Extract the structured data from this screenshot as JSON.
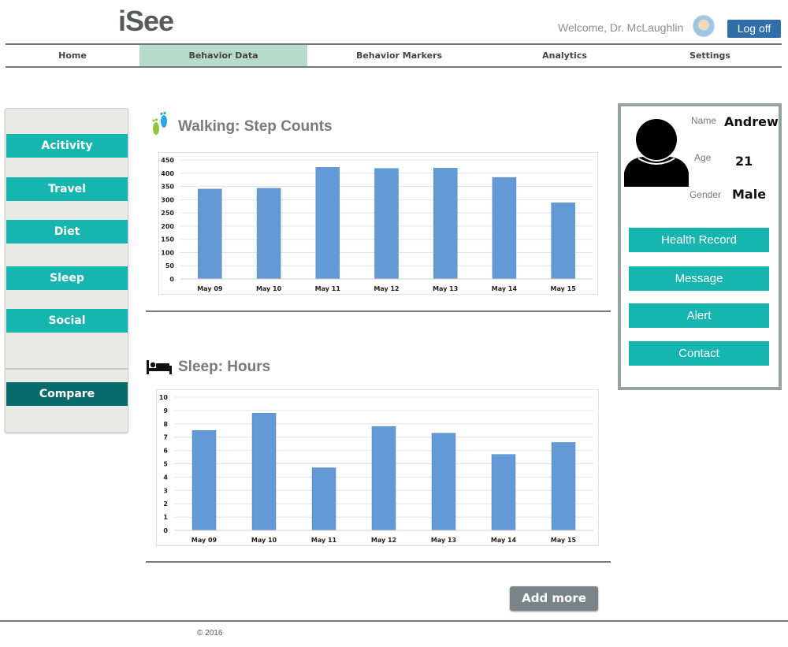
{
  "header": {
    "logo": "iSee",
    "welcome": "Welcome, Dr. McLaughlin",
    "logoff_label": "Log off"
  },
  "nav": {
    "items": [
      {
        "label": "Home"
      },
      {
        "label": "Behavior Data"
      },
      {
        "label": "Behavior Markers"
      },
      {
        "label": "Analytics"
      },
      {
        "label": "Settings"
      }
    ],
    "active": "Behavior Data"
  },
  "sidebar": {
    "items": [
      {
        "label": "Acitivity"
      },
      {
        "label": "Travel"
      },
      {
        "label": "Diet"
      },
      {
        "label": "Sleep"
      },
      {
        "label": "Social"
      }
    ],
    "compare_label": "Compare"
  },
  "sections": {
    "walking_title": "Walking: Step Counts",
    "sleep_title": "Sleep: Hours"
  },
  "profile": {
    "name_label": "Name",
    "name": "Andrew",
    "age_label": "Age",
    "age": "21",
    "gender_label": "Gender",
    "gender": "Male",
    "buttons": [
      {
        "label": "Health Record"
      },
      {
        "label": "Message"
      },
      {
        "label": "Alert"
      },
      {
        "label": "Contact"
      }
    ]
  },
  "add_more_label": "Add more",
  "footer": {
    "copyright": "© 2016"
  },
  "colors": {
    "accent": "#16b5b0",
    "bar": "#6399d4",
    "nav_active": "#b7dccd",
    "compare": "#0a6b6c"
  },
  "chart_data": [
    {
      "type": "bar",
      "title": "Walking: Step Counts",
      "categories": [
        "May 09",
        "May 10",
        "May 11",
        "May 12",
        "May 13",
        "May 14",
        "May 15"
      ],
      "values": [
        340,
        343,
        422,
        418,
        419,
        384,
        288
      ],
      "yticks": [
        "0",
        "50",
        "100",
        "150",
        "200",
        "250",
        "300",
        "350",
        "400",
        "450"
      ],
      "ylim": [
        0,
        450
      ],
      "grid": true
    },
    {
      "type": "bar",
      "title": "Sleep: Hours",
      "categories": [
        "May 09",
        "May 10",
        "May 11",
        "May 12",
        "May 13",
        "May 14",
        "May 15"
      ],
      "values": [
        7.5,
        8.8,
        4.7,
        7.8,
        7.3,
        5.7,
        6.6
      ],
      "yticks": [
        "0",
        "1",
        "2",
        "3",
        "4",
        "5",
        "6",
        "7",
        "8",
        "9",
        "10"
      ],
      "ylim": [
        0,
        10
      ],
      "grid": true
    }
  ]
}
